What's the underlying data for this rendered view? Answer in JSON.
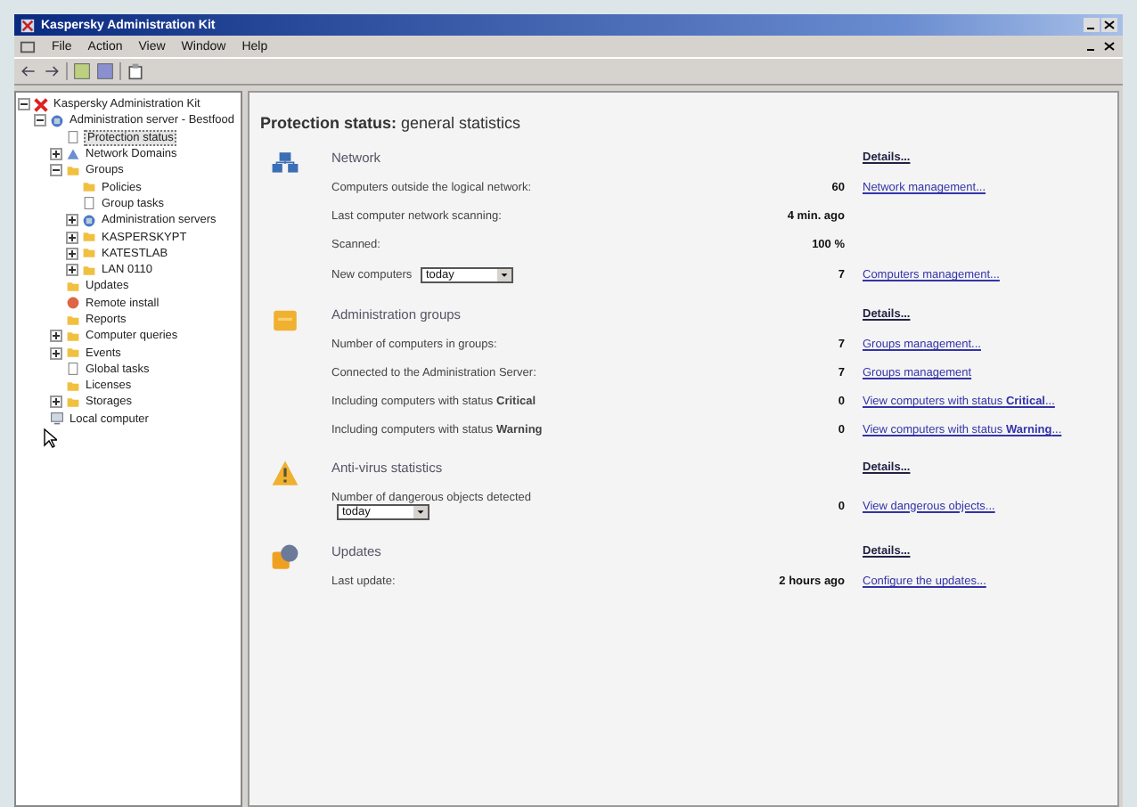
{
  "window": {
    "title": "Kaspersky Administration Kit"
  },
  "menu": [
    "File",
    "Action",
    "View",
    "Window",
    "Help"
  ],
  "tree": [
    {
      "label": "Kaspersky Administration Kit",
      "kind": "kaspersky",
      "expanded": true,
      "selected": false,
      "children": [
        {
          "label": "Administration server - Bestfood",
          "kind": "server",
          "expanded": true,
          "selected": false,
          "children": [
            {
              "label": "Protection status",
              "kind": "page",
              "selected": true
            },
            {
              "label": "Network Domains",
              "kind": "network",
              "expanded": false,
              "selected": false
            },
            {
              "label": "Groups",
              "kind": "folder",
              "expanded": true,
              "selected": false,
              "children": [
                {
                  "label": "Policies",
                  "kind": "folder",
                  "selected": false
                },
                {
                  "label": "Group tasks",
                  "kind": "page",
                  "selected": false
                },
                {
                  "label": "Administration servers",
                  "kind": "server",
                  "expanded": false,
                  "selected": false
                },
                {
                  "label": "KASPERSKYPT",
                  "kind": "folder",
                  "expanded": false,
                  "selected": false
                },
                {
                  "label": "KATESTLAB",
                  "kind": "folder",
                  "expanded": false,
                  "selected": false
                },
                {
                  "label": "LAN 0110",
                  "kind": "folder",
                  "expanded": false,
                  "selected": false
                }
              ]
            },
            {
              "label": "Updates",
              "kind": "folder",
              "selected": false
            },
            {
              "label": "Remote install",
              "kind": "install",
              "selected": false
            },
            {
              "label": "Reports",
              "kind": "folder",
              "selected": false
            },
            {
              "label": "Computer queries",
              "kind": "folder",
              "expanded": false,
              "selected": false
            },
            {
              "label": "Events",
              "kind": "folder",
              "expanded": false,
              "selected": false
            },
            {
              "label": "Global tasks",
              "kind": "page",
              "selected": false
            },
            {
              "label": "Licenses",
              "kind": "folder",
              "selected": false
            },
            {
              "label": "Storages",
              "kind": "folder",
              "expanded": false,
              "selected": false
            }
          ]
        },
        {
          "label": "Local computer",
          "kind": "computer",
          "selected": false
        }
      ]
    }
  ],
  "heading": "**Protection status:** general statistics",
  "sections": [
    {
      "kind": "network",
      "title": "Network",
      "details": "Details...",
      "rows": [
        {
          "label": "Computers outside the logical network:",
          "value": "60",
          "link": "Network management..."
        },
        {
          "label": "Last computer network scanning:",
          "value": "4 min. ago"
        },
        {
          "label": "Scanned:",
          "value": "100 %"
        },
        {
          "label": "New computers",
          "dropdown": "today",
          "value": "7",
          "link": "Computers management..."
        }
      ]
    },
    {
      "kind": "groups",
      "title": "Administration groups",
      "details": "Details...",
      "rows": [
        {
          "label": "Number of computers in groups:",
          "value": "7",
          "link": "Groups management..."
        },
        {
          "label": "Connected to the Administration Server:",
          "value": "7",
          "link": "Groups management"
        },
        {
          "label": "Including computers with status **Critical**",
          "value": "0",
          "link": "View computers with status **Critical**..."
        },
        {
          "label": "Including computers with status **Warning**",
          "value": "0",
          "link": "View computers with status **Warning**..."
        }
      ]
    },
    {
      "kind": "antivirus",
      "title": "Anti-virus statistics",
      "details": "Details...",
      "rows": [
        {
          "label": "Number of dangerous objects detected",
          "dropdown_below": "today",
          "value": "0",
          "link": "View dangerous objects..."
        }
      ]
    },
    {
      "kind": "updates",
      "title": "Updates",
      "details": "Details...",
      "rows": [
        {
          "label": "Last update:",
          "value": "2 hours ago",
          "link": "Configure the updates..."
        }
      ]
    }
  ]
}
